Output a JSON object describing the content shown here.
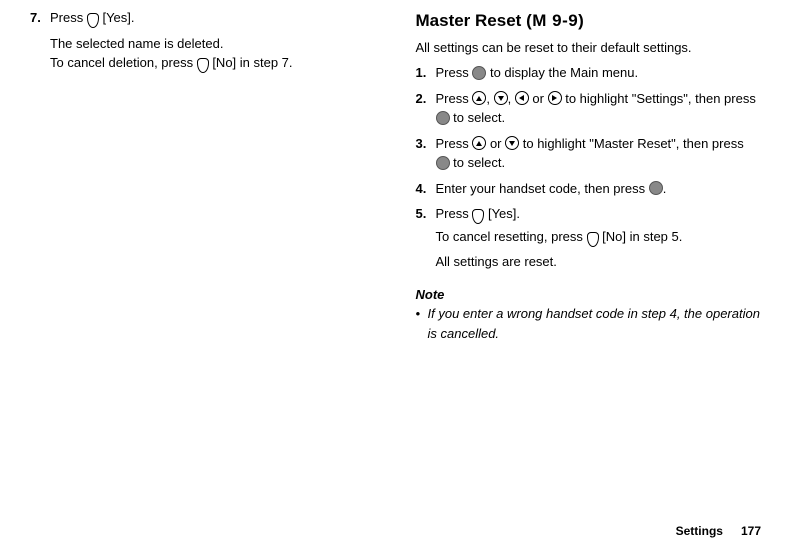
{
  "left": {
    "step7": {
      "num": "7.",
      "line1a": "Press ",
      "line1b": " [Yes].",
      "line2": "The selected name is deleted.",
      "line3a": "To cancel deletion, press ",
      "line3b": " [No] in step 7."
    }
  },
  "right": {
    "title": "Master Reset",
    "mcode": "(M 9-9)",
    "intro": "All settings can be reset to their default settings.",
    "steps": {
      "s1": {
        "num": "1.",
        "a": "Press ",
        "b": " to display the Main menu."
      },
      "s2": {
        "num": "2.",
        "a": "Press ",
        "b": ", ",
        "c": ", ",
        "d": " or ",
        "e": " to highlight \"Settings\", then press ",
        "f": " to select."
      },
      "s3": {
        "num": "3.",
        "a": "Press ",
        "b": " or ",
        "c": " to highlight \"Master Reset\", then press ",
        "d": " to select."
      },
      "s4": {
        "num": "4.",
        "a": "Enter your handset code, then press ",
        "b": "."
      },
      "s5": {
        "num": "5.",
        "a": "Press ",
        "b": " [Yes].",
        "c": "To cancel resetting, press ",
        "d": " [No] in step 5.",
        "e": "All settings are reset."
      }
    },
    "noteLabel": "Note",
    "noteBullet": "•",
    "noteText": "If you enter a wrong handset code in step 4, the operation is cancelled."
  },
  "footer": {
    "label": "Settings",
    "page": "177"
  }
}
